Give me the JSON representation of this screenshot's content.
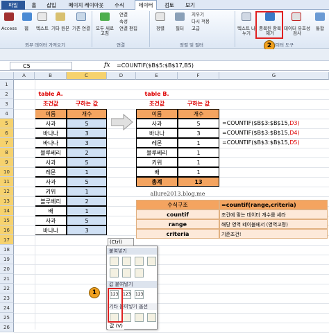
{
  "tabs": [
    "파일",
    "홈",
    "삽입",
    "페이지 레이아웃",
    "수식",
    "데이터",
    "검토",
    "보기"
  ],
  "active_tab": "데이터",
  "ribbon": {
    "buttons": [
      "Access",
      "웹",
      "텍스트",
      "기타 원본",
      "기존 연결",
      "모두 새로 고침",
      "연결",
      "속성",
      "연결 편집",
      "정렬",
      "필터",
      "지우기",
      "다시 적용",
      "고급",
      "텍스트 나누기",
      "중복된 항목 제거",
      "데이터 유효성 검사",
      "통합"
    ],
    "groups": [
      "외부 데이터 가져오기",
      "연결",
      "정렬 및 필터",
      "데이터 도구"
    ]
  },
  "name_box": "C5",
  "fx": "fx",
  "formula": "=COUNTIF($B$5:$B$17,B5)",
  "columns": [
    "A",
    "B",
    "C",
    "D",
    "E",
    "F",
    "G"
  ],
  "rows": [
    "1",
    "2",
    "3",
    "4",
    "5",
    "6",
    "7",
    "8",
    "9",
    "10",
    "11",
    "12",
    "13",
    "14",
    "15",
    "16",
    "17",
    "18",
    "19",
    "20",
    "21",
    "22",
    "23",
    "24",
    "25",
    "26"
  ],
  "table_a": {
    "title": "table A.",
    "sub1": "조건값",
    "sub2": "구하는 값",
    "h1": "이름",
    "h2": "개수",
    "rows": [
      [
        "사과",
        "5"
      ],
      [
        "바나나",
        "3"
      ],
      [
        "바나나",
        "3"
      ],
      [
        "블루베리",
        "2"
      ],
      [
        "사과",
        "5"
      ],
      [
        "레몬",
        "1"
      ],
      [
        "사과",
        "5"
      ],
      [
        "키위",
        "1"
      ],
      [
        "블루베리",
        "2"
      ],
      [
        "배",
        "1"
      ],
      [
        "사과",
        "5"
      ],
      [
        "바나나",
        "3"
      ]
    ]
  },
  "table_b": {
    "title": "table B.",
    "sub1": "조건값",
    "sub2": "구하는 값",
    "h1": "이름",
    "h2": "개수",
    "rows": [
      [
        "사과",
        "5"
      ],
      [
        "바나나",
        "3"
      ],
      [
        "레몬",
        "1"
      ],
      [
        "블루베리",
        "1"
      ],
      [
        "키위",
        "1"
      ],
      [
        "배",
        "1"
      ]
    ],
    "total_label": "총계",
    "total_value": "13"
  },
  "formulas": [
    {
      "text": "=COUNTIF($B$3:$B$15,",
      "ref": "D3)"
    },
    {
      "text": "=COUNTIF($B$3:$B$15,",
      "ref": "D4)"
    },
    {
      "text": "=COUNTIF($B$3:$B$15,",
      "ref": "D5)"
    }
  ],
  "watermark": "allure2013.blog.me",
  "struct": {
    "h1": "수식구조",
    "h2": "=countif(range,criteria)",
    "rows": [
      [
        "countif",
        "조건에 맞는 데이터 개수를 세라"
      ],
      [
        "range",
        "해당 영역 테이블에서 (영역고정)"
      ],
      [
        "criteria",
        "기준조건!"
      ]
    ]
  },
  "popup": {
    "ctrl": "(Ctrl)",
    "section1": "붙여넣기",
    "section2": "값 붙여넣기",
    "section3": "기타 붙여넣기 옵션",
    "value_label": "값 (V)",
    "icon_123": "123"
  },
  "badges": [
    "1",
    "2"
  ],
  "colors": {
    "header": "#f4a460",
    "blue_fill": "#cfe0f4",
    "red": "#d00000",
    "badge": "#f0a020"
  }
}
